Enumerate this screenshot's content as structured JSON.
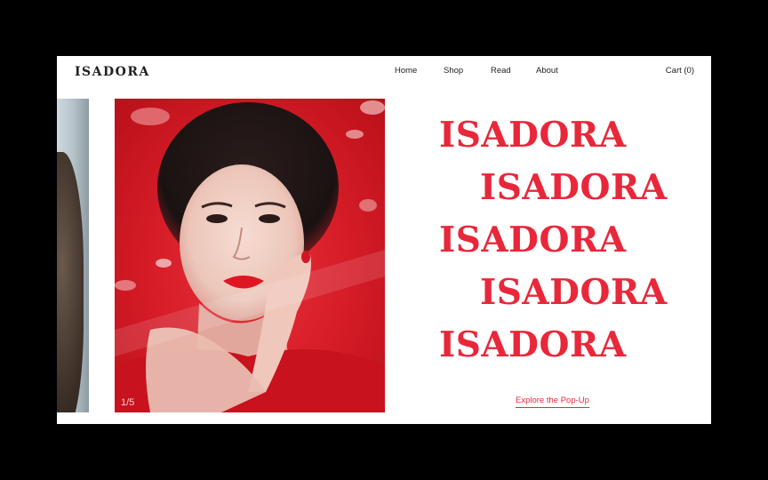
{
  "brand": {
    "name": "ISADORA"
  },
  "nav": {
    "items": [
      "Home",
      "Shop",
      "Read",
      "About"
    ]
  },
  "cart": {
    "label": "Cart (0)"
  },
  "carousel": {
    "counter": "1/5"
  },
  "hero": {
    "words": [
      "ISADORA",
      "ISADORA",
      "ISADORA",
      "ISADORA",
      "ISADORA"
    ]
  },
  "cta": {
    "label": "Explore the Pop-Up"
  },
  "colors": {
    "accent": "#e8283a",
    "photo_red": "#d41b26"
  }
}
